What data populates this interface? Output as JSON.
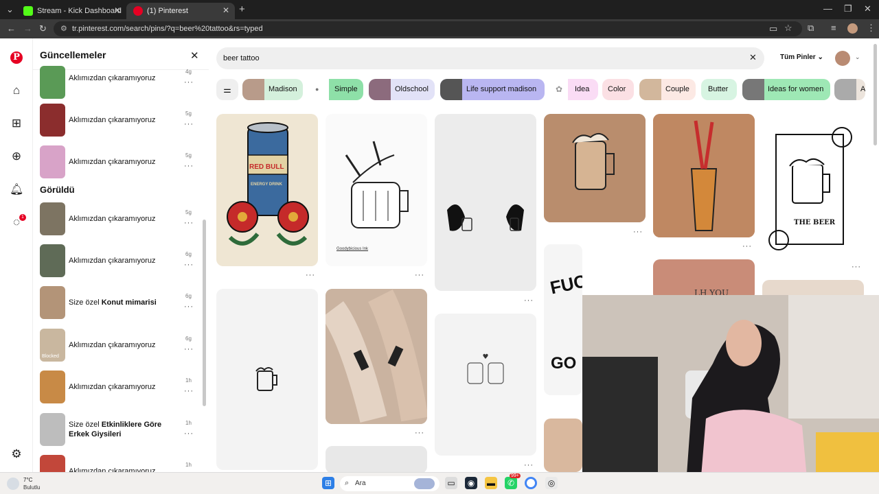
{
  "browser": {
    "tabs": [
      {
        "label": "Stream - Kick Dashboard",
        "active": false,
        "favicon_color": "#53fc18"
      },
      {
        "label": "(1) Pinterest",
        "active": true,
        "favicon_color": "#e60023"
      }
    ],
    "new_tab": "+",
    "url": "tr.pinterest.com/search/pins/?q=beer%20tattoo&rs=typed"
  },
  "rail": {
    "logo": "P",
    "icons": [
      "home-icon",
      "explore-icon",
      "create-icon",
      "notifications-icon",
      "messages-icon",
      "settings-icon"
    ],
    "messages_badge": "1"
  },
  "updates_panel": {
    "title": "Güncellemeler",
    "close": "✕",
    "seen_title": "Görüldü",
    "items": [
      {
        "text": "Aklımızdan çıkaramıyoruz",
        "bold": "",
        "time": "4g",
        "thumb": "#5a9a56"
      },
      {
        "text": "Aklımızdan çıkaramıyoruz",
        "bold": "",
        "time": "5g",
        "thumb": "#8b2d2d"
      },
      {
        "text": "Aklımızdan çıkaramıyoruz",
        "bold": "",
        "time": "5g",
        "thumb": "#d8a3c8"
      },
      {
        "text": "Aklımızdan çıkaramıyoruz",
        "bold": "",
        "time": "5g",
        "thumb": "#7d7462"
      },
      {
        "text": "Aklımızdan çıkaramıyoruz",
        "bold": "",
        "time": "6g",
        "thumb": "#5f6b57"
      },
      {
        "text": "Size özel ",
        "bold": "Konut mimarisi",
        "time": "6g",
        "thumb": "#b39478"
      },
      {
        "text": "Aklımızdan çıkaramıyoruz",
        "bold": "",
        "time": "6g",
        "thumb": "#c9b79f",
        "thumb_label": "Blocked"
      },
      {
        "text": "Aklımızdan çıkaramıyoruz",
        "bold": "",
        "time": "1h",
        "thumb": "#c88a46"
      },
      {
        "text": "Size özel ",
        "bold": "Etkinliklere Göre Erkek Giysileri",
        "time": "1h",
        "thumb": "#bdbdbd"
      },
      {
        "text": "Aklımızdan çıkaramıyoruz",
        "bold": "",
        "time": "1h",
        "thumb": "#c2473a"
      }
    ],
    "dots": "···"
  },
  "search": {
    "query": "beer tattoo",
    "clear": "✕",
    "scope": "Tüm Pinler",
    "filter_icon": "filter-icon"
  },
  "chips": [
    {
      "label": "Madison",
      "bg": "#d4f0dc",
      "img": "#b89b8a"
    },
    {
      "label": "Simple",
      "bg": "#8ee0a8",
      "img": ""
    },
    {
      "label": "Oldschool",
      "bg": "#e2e2f7",
      "img": "#8c6b7d"
    },
    {
      "label": "Life support madison",
      "bg": "#b9b6f1",
      "img": "#555555"
    },
    {
      "label": "Idea",
      "bg": "#fadcf5",
      "img": ""
    },
    {
      "label": "Color",
      "bg": "#fbe0e4",
      "img": ""
    },
    {
      "label": "Couple",
      "bg": "#fce9e4",
      "img": "#d2b79c"
    },
    {
      "label": "Butter",
      "bg": "#d7f4e2",
      "img": ""
    },
    {
      "label": "Ideas for women",
      "bg": "#9ee8b5",
      "img": "#777777"
    },
    {
      "label": "A",
      "bg": "#ece4dc",
      "img": "#aaaaaa"
    }
  ],
  "pins": {
    "red_bull_can_text": "RED BULL",
    "red_bull_sub": "ENERGY DRINK",
    "sticker_caption": "Goodybicious Ink",
    "poster_text": "FUCK WOR",
    "poster_text2": "GO",
    "tarot_text": "THE BEER",
    "skin_text": "LH YOU"
  },
  "taskbar": {
    "weather_temp": "7°C",
    "weather_desc": "Bulutlu",
    "search_placeholder": "Ara",
    "badge": "99+"
  }
}
